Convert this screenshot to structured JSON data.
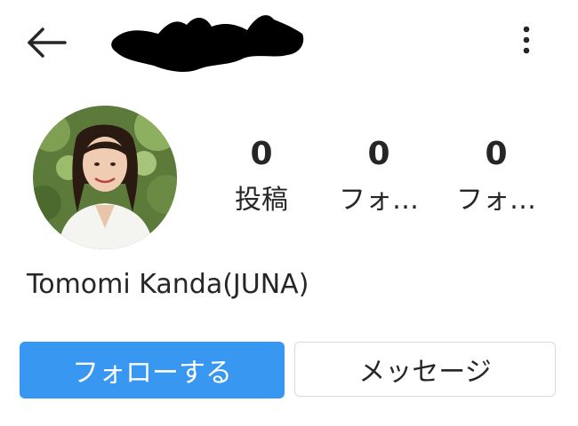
{
  "header": {
    "back_icon": "arrow-left-icon",
    "more_icon": "more-vertical-icon"
  },
  "profile": {
    "full_name": "Tomomi Kanda(JUNA)",
    "stats": [
      {
        "count": "0",
        "label": "投稿"
      },
      {
        "count": "0",
        "label": "フォ…"
      },
      {
        "count": "0",
        "label": "フォ…"
      }
    ]
  },
  "actions": {
    "follow_label": "フォローする",
    "message_label": "メッセージ"
  },
  "colors": {
    "follow_button": "#3897f0",
    "text": "#262626",
    "border": "#dbdbdb"
  }
}
